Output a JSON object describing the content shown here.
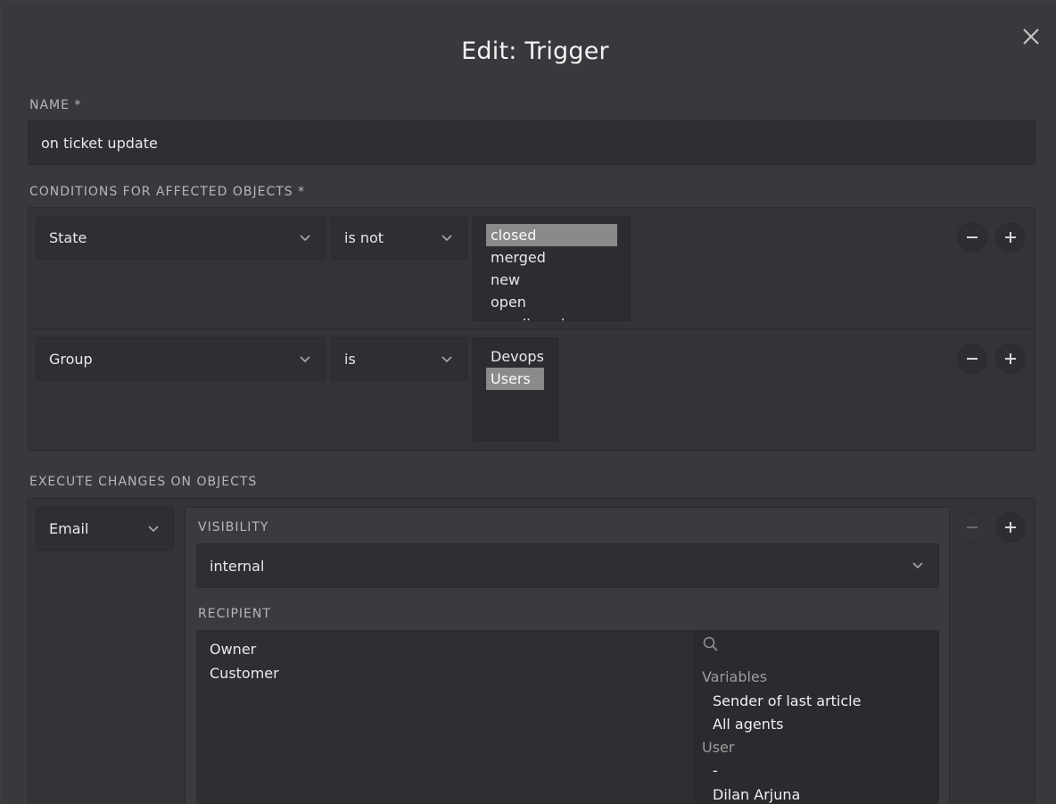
{
  "modal": {
    "title": "Edit: Trigger",
    "close_icon": "close-icon"
  },
  "name": {
    "label": "NAME *",
    "value": "on ticket update"
  },
  "conditions": {
    "label": "CONDITIONS FOR AFFECTED OBJECTS *",
    "rows": [
      {
        "attribute": "State",
        "operator": "is not",
        "options": [
          {
            "label": "closed",
            "selected": true
          },
          {
            "label": "merged",
            "selected": false
          },
          {
            "label": "new",
            "selected": false
          },
          {
            "label": "open",
            "selected": false
          },
          {
            "label": "pending close",
            "selected": false
          }
        ]
      },
      {
        "attribute": "Group",
        "operator": "is",
        "options": [
          {
            "label": "Devops",
            "selected": false
          },
          {
            "label": "Users",
            "selected": true
          }
        ]
      }
    ]
  },
  "execute": {
    "label": "EXECUTE CHANGES ON OBJECTS",
    "action": "Email",
    "visibility_label": "VISIBILITY",
    "visibility_value": "internal",
    "recipient_label": "RECIPIENT",
    "recipients": [
      "Owner",
      "Customer"
    ],
    "picker": {
      "search_icon": "search-icon",
      "groups": [
        {
          "heading": "Variables",
          "items": [
            "Sender of last article",
            "All agents"
          ]
        },
        {
          "heading": "User",
          "items": [
            "-",
            "Dilan Arjuna"
          ]
        }
      ]
    }
  },
  "colors": {
    "background": "#38393d",
    "field": "#2e2f33",
    "selected_option": "#8a8a8a"
  }
}
